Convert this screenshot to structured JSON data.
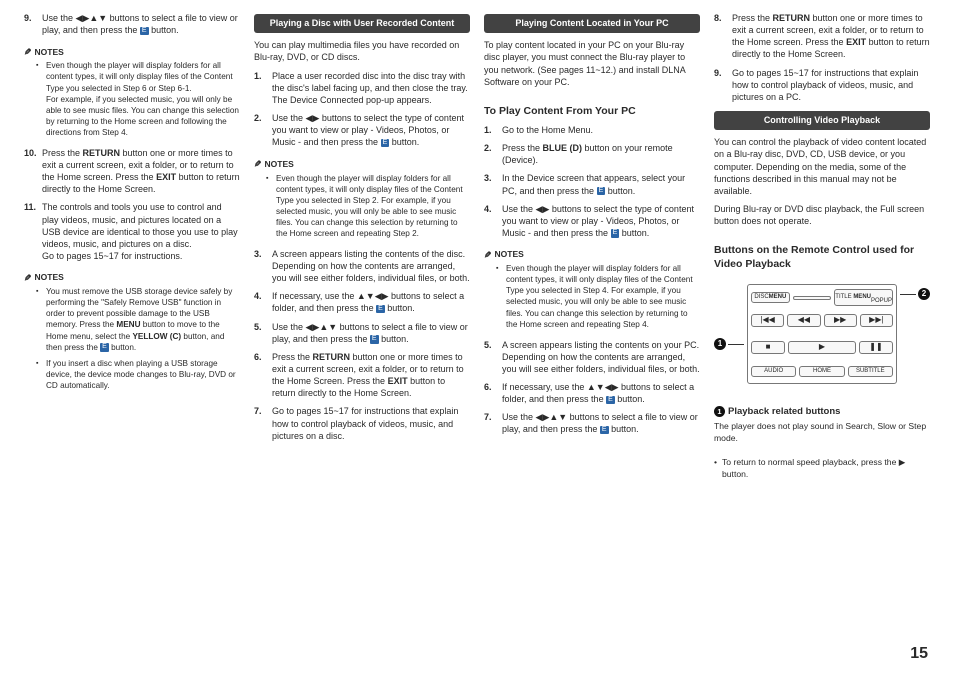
{
  "page_number": "15",
  "icons": {
    "enter": "E"
  },
  "col1": {
    "steps_a": [
      {
        "n": "9.",
        "t": "Use the ◀▶▲▼ buttons to select a file to view or play, and then press the [E] button."
      }
    ],
    "notes_a_label": "NOTES",
    "notes_a": [
      "Even though the player will display folders for all content types, it will only display files of the Content Type you selected in Step 6 or Step 6-1.\nFor example, if you selected music, you will only be able to see music files. You can change this selection by returning to the Home screen and following the directions from Step 4."
    ],
    "steps_b": [
      {
        "n": "10.",
        "t": "Press the RETURN button one or more times to exit a current screen, exit a folder, or to return to the Home screen. Press the EXIT button to return directly to the Home Screen."
      },
      {
        "n": "11.",
        "t": "The controls and tools you use to control and play videos, music, and pictures located on a USB device are identical to those you use to play videos, music, and pictures on a disc.\nGo to pages 15~17 for instructions."
      }
    ],
    "notes_b_label": "NOTES",
    "notes_b": [
      "You must remove the USB storage device safely by performing the \"Safely Remove USB\" function in order to prevent possible damage to the USB memory. Press the MENU button to move to the Home menu, select the YELLOW (C) button, and then press the [E] button.",
      "If you insert a disc when playing a USB storage device, the device mode changes to Blu-ray, DVD or CD automatically."
    ]
  },
  "col2": {
    "banner": "Playing a Disc with User Recorded Content",
    "intro": "You can play multimedia files you have recorded on Blu-ray, DVD, or CD discs.",
    "steps_a": [
      {
        "n": "1.",
        "t": "Place a user recorded disc into the disc tray with the disc's label facing up, and then close the tray. The Device Connected pop-up appears."
      },
      {
        "n": "2.",
        "t": "Use the ◀▶ buttons to select the type of content you want to view or play - Videos, Photos, or Music - and then press the [E] button."
      }
    ],
    "notes_label": "NOTES",
    "notes": [
      "Even though the player will display folders for all content types, it will only display files of the Content Type you selected in Step 2. For example, if you selected music, you will only be able to see music files. You can change this selection by returning to the Home screen and repeating Step 2."
    ],
    "steps_b": [
      {
        "n": "3.",
        "t": "A screen appears listing the contents of the disc. Depending on how the contents are arranged, you will see either folders, individual files, or both."
      },
      {
        "n": "4.",
        "t": "If necessary, use the ▲▼◀▶ buttons to select a folder, and then press the [E] button."
      },
      {
        "n": "5.",
        "t": "Use the ◀▶▲▼ buttons to select a file to view or play, and then press the [E] button."
      },
      {
        "n": "6.",
        "t": "Press the RETURN button one or more times to exit a current screen, exit a folder, or to return to the Home Screen. Press the EXIT button to return directly to the Home Screen."
      },
      {
        "n": "7.",
        "t": "Go to pages 15~17 for instructions that explain how to control playback of videos, music, and pictures on a disc."
      }
    ]
  },
  "col3": {
    "banner": "Playing Content Located in Your PC",
    "intro": "To play content located in your PC on your Blu-ray disc player, you must connect the Blu-ray player to you network. (See pages 11~12.) and install DLNA Software on your PC.",
    "heading": "To Play Content From Your PC",
    "steps_a": [
      {
        "n": "1.",
        "t": "Go to the Home Menu."
      },
      {
        "n": "2.",
        "t": "Press the BLUE (D) button on your remote (Device)."
      },
      {
        "n": "3.",
        "t": "In the Device screen that appears, select your PC, and then press the [E] button."
      },
      {
        "n": "4.",
        "t": "Use the ◀▶ buttons to select the type of content you want to view or play - Videos, Photos, or Music - and then press the [E] button."
      }
    ],
    "notes_label": "NOTES",
    "notes": [
      "Even though the player will display folders for all content types, it will only display files of the Content Type you selected in Step 4. For example, if you selected music, you will only be able to see music files. You can change this selection by returning to the Home screen and repeating Step 4."
    ],
    "steps_b": [
      {
        "n": "5.",
        "t": "A screen appears listing the contents on your PC. Depending on how the contents are arranged, you will see either folders, individual files, or both."
      },
      {
        "n": "6.",
        "t": "If necessary, use the ▲▼◀▶ buttons to select a folder, and then press the [E] button."
      },
      {
        "n": "7.",
        "t": "Use the ◀▶▲▼ buttons to select a file to view or play, and then press the [E] button."
      }
    ]
  },
  "col4": {
    "steps_cont": [
      {
        "n": "8.",
        "t": "Press the RETURN button one or more times to exit a current screen, exit a folder, or to return to the Home screen. Press the EXIT button to return directly to the Home Screen."
      },
      {
        "n": "9.",
        "t": "Go to pages 15~17 for instructions that explain how to control playback of videos, music, and pictures on a PC."
      }
    ],
    "banner": "Controlling Video Playback",
    "para1": "You can control the playback of video content located on a Blu-ray disc, DVD, CD, USB device, or you computer. Depending on the media, some of the functions described in this manual may not be available.",
    "para2": "During Blu-ray or DVD disc playback, the Full screen button does not operate.",
    "heading": "Buttons on the Remote Control used for Video Playback",
    "remote": {
      "row1": [
        "DISC MENU",
        "",
        "TITLE MENU\nPOPUP"
      ],
      "row2": [
        "|◀◀",
        "◀◀",
        "▶▶",
        "▶▶|"
      ],
      "row3": [
        "■",
        "▶",
        "❚❚"
      ],
      "row4": [
        "AUDIO",
        "HOME",
        "SUBTITLE"
      ]
    },
    "callouts": {
      "c1": "1",
      "c2": "2"
    },
    "sub_head": "Playback related buttons",
    "sub_note": "The player does not play sound in Search, Slow or Step mode.",
    "tip": "To return to normal speed playback, press the ▶ button."
  }
}
